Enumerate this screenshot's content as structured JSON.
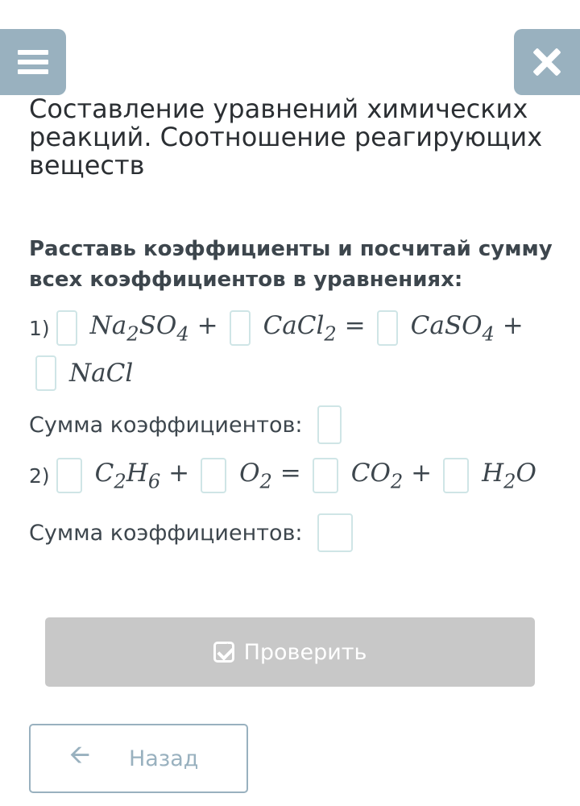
{
  "header": {
    "menu_icon": "hamburger-menu-icon",
    "close_icon": "close-x-icon",
    "accent_color": "#99b1bf"
  },
  "title": "Составление уравнений химических реакций. Соотношение реагирующих веществ",
  "instruction": "Расставь коэффициенты и посчитай сумму всех коэффициентов в уравнениях:",
  "equation1": {
    "number": "1)",
    "t1": "Na",
    "t1s": "2",
    "t1b": "SO",
    "t1bs": "4",
    "op1": "+",
    "t2": "CaCl",
    "t2s": "2",
    "eq": "=",
    "t3": "CaSO",
    "t3s": "4",
    "op2": "+",
    "t4": "NaCl"
  },
  "equation2": {
    "number": "2)",
    "t1": "C",
    "t1s": "2",
    "t1b": "H",
    "t1bs": "6",
    "op1": "+",
    "t2": "O",
    "t2s": "2",
    "eq": "=",
    "t3": "CO",
    "t3s": "2",
    "op2": "+",
    "t4": "H",
    "t4s": "2",
    "t4b": "O"
  },
  "sum_label": "Сумма коэффициентов:",
  "check_button": {
    "label": "Проверить",
    "icon": "checkbox-check-icon"
  },
  "back_button": {
    "label": "Назад",
    "icon": "arrow-left-icon"
  }
}
